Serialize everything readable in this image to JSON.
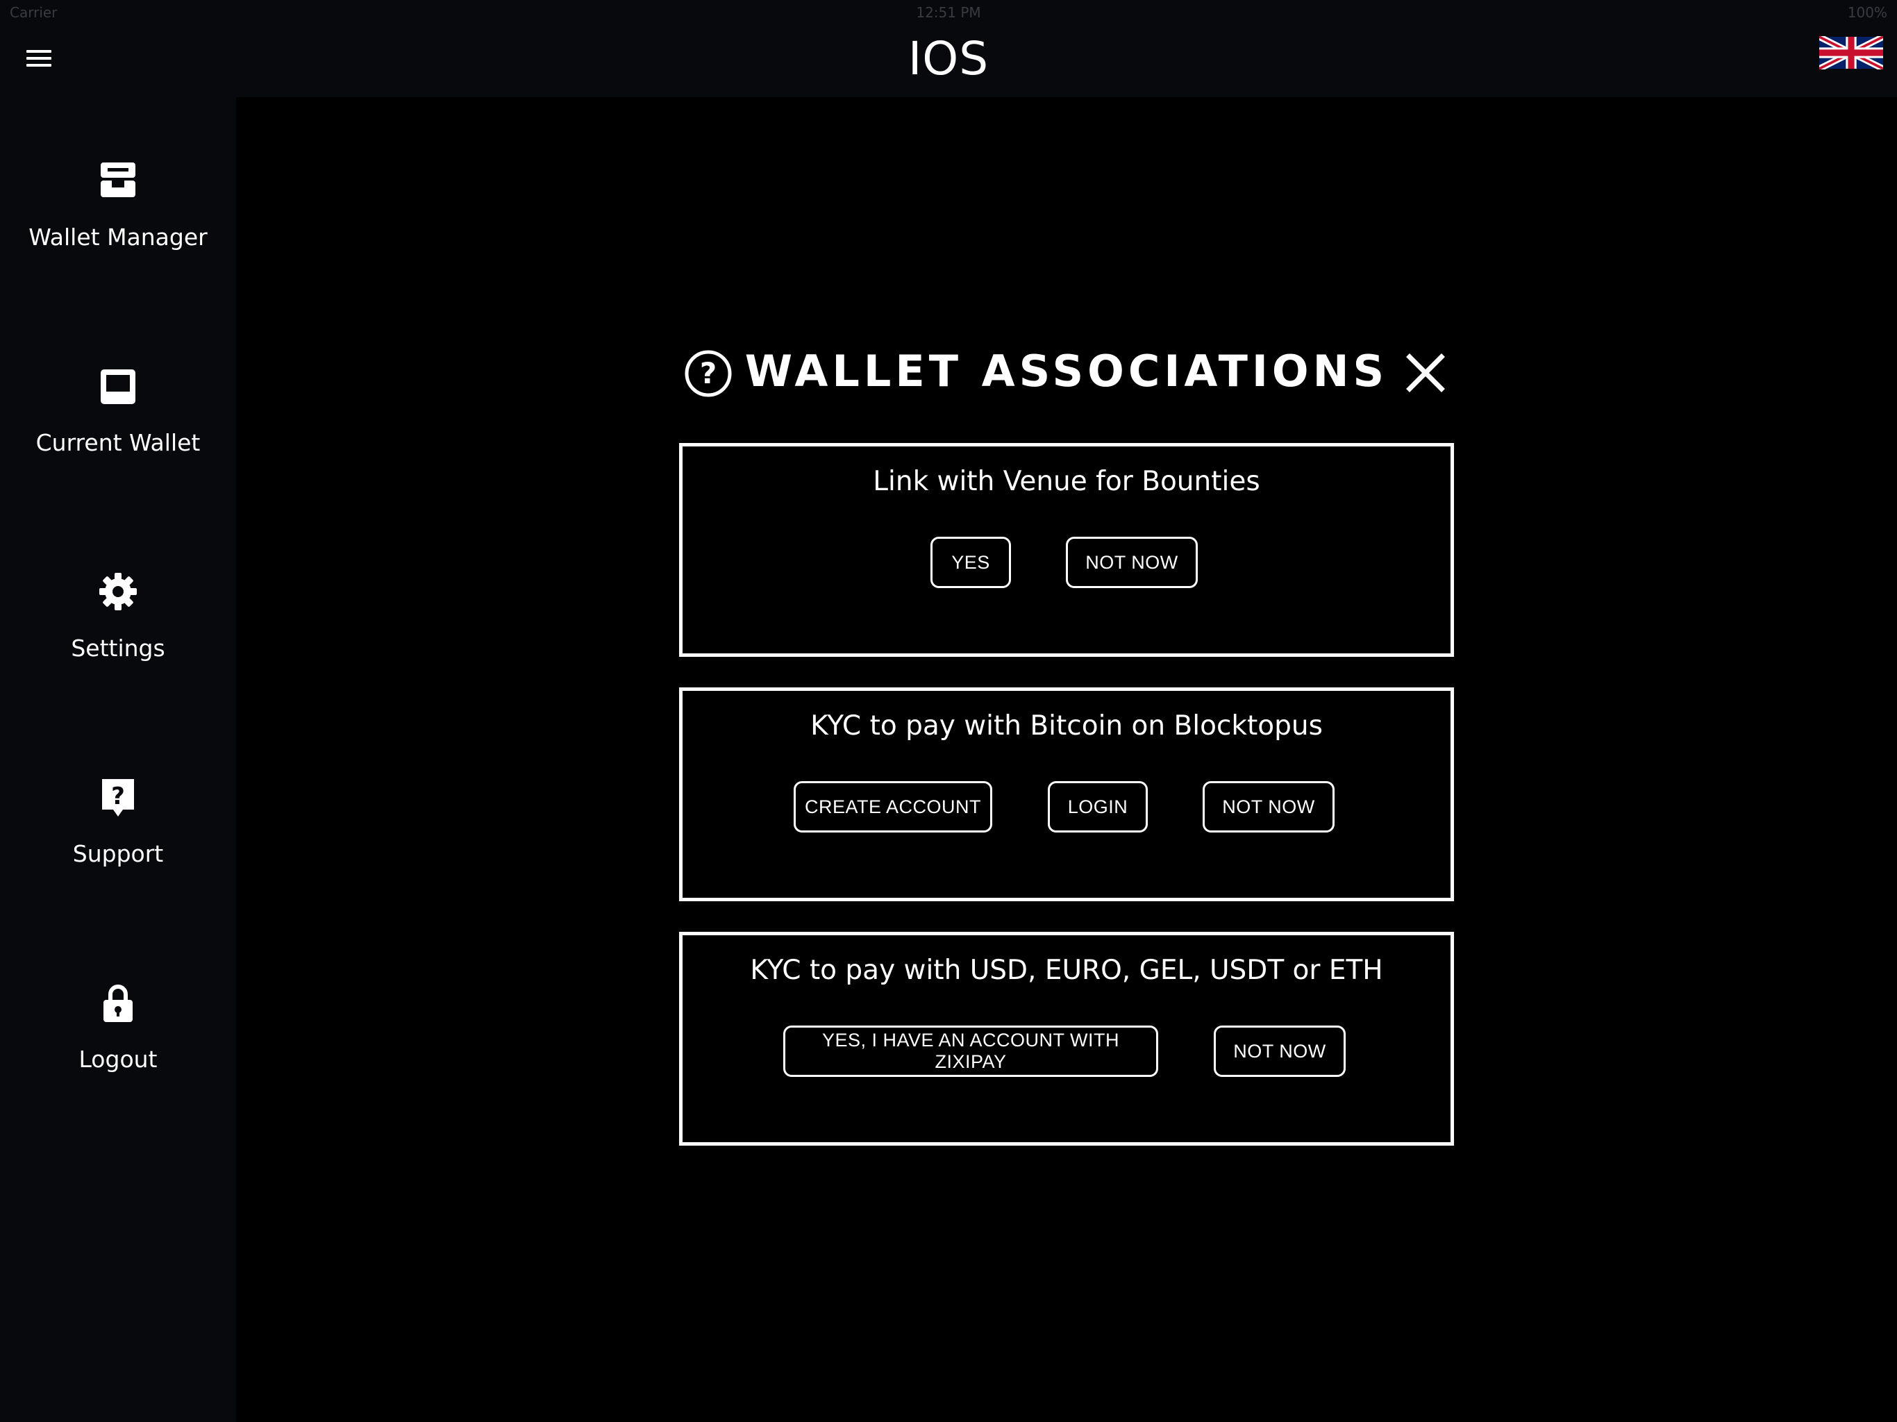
{
  "status": {
    "carrier": "Carrier",
    "time": "12:51 PM",
    "battery": "100%"
  },
  "app": {
    "title": "IOS",
    "menu_icon": "hamburger-icon",
    "language_icon": "uk-flag-icon"
  },
  "sidebar": {
    "items": [
      {
        "label": "Wallet Manager",
        "icon": "wallet-manager-icon"
      },
      {
        "label": "Current Wallet",
        "icon": "current-wallet-icon"
      },
      {
        "label": "Settings",
        "icon": "gear-icon"
      },
      {
        "label": "Support",
        "icon": "support-icon"
      },
      {
        "label": "Logout",
        "icon": "lock-icon"
      }
    ]
  },
  "modal": {
    "title": "WALLET ASSOCIATIONS",
    "help_icon": "help-icon",
    "close_icon": "close-icon",
    "cards": [
      {
        "title": "Link with Venue for Bounties",
        "buttons": [
          "YES",
          "NOT NOW"
        ]
      },
      {
        "title": "KYC to pay with Bitcoin on Blocktopus",
        "buttons": [
          "CREATE ACCOUNT",
          "LOGIN",
          "NOT NOW"
        ]
      },
      {
        "title": "KYC to pay with USD, EURO, GEL, USDT or ETH",
        "buttons": [
          "YES, I HAVE AN ACCOUNT WITH ZIXIPAY",
          "NOT NOW"
        ]
      }
    ]
  },
  "colors": {
    "background": "#000000",
    "bar": "#08090d",
    "foreground": "#ffffff"
  }
}
